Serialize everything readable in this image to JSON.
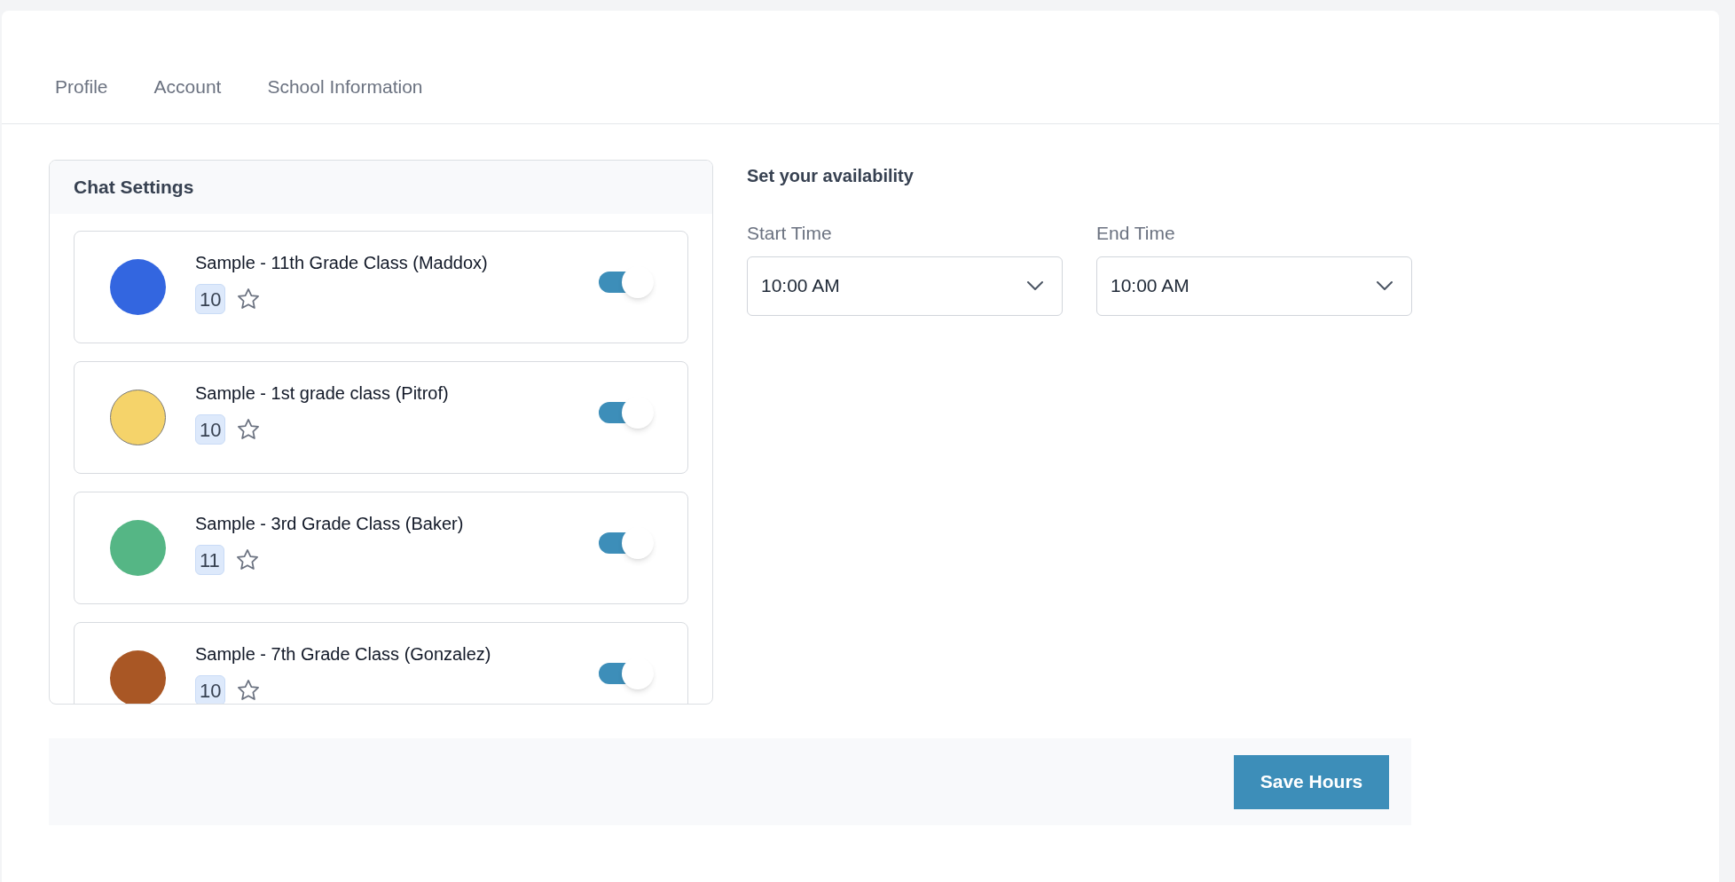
{
  "tabs": [
    {
      "label": "Profile"
    },
    {
      "label": "Account"
    },
    {
      "label": "School Information"
    }
  ],
  "chat_settings": {
    "title": "Chat Settings",
    "items": [
      {
        "name": "Sample - 11th Grade Class (Maddox)",
        "count": "10",
        "color": "#3366e0",
        "outlined": false,
        "starred": false,
        "on": true
      },
      {
        "name": "Sample - 1st grade class (Pitrof)",
        "count": "10",
        "color": "#f5d36a",
        "outlined": true,
        "starred": false,
        "on": true
      },
      {
        "name": "Sample - 3rd Grade Class (Baker)",
        "count": "11",
        "color": "#55b685",
        "outlined": false,
        "starred": false,
        "on": true
      },
      {
        "name": "Sample - 7th Grade Class (Gonzalez)",
        "count": "10",
        "color": "#a95725",
        "outlined": false,
        "starred": false,
        "on": true
      }
    ]
  },
  "availability": {
    "title": "Set your availability",
    "fields": [
      {
        "label": "Start Time",
        "value": "10:00 AM"
      },
      {
        "label": "End Time",
        "value": "10:00 AM"
      }
    ]
  },
  "footer": {
    "button": "Save Hours"
  }
}
